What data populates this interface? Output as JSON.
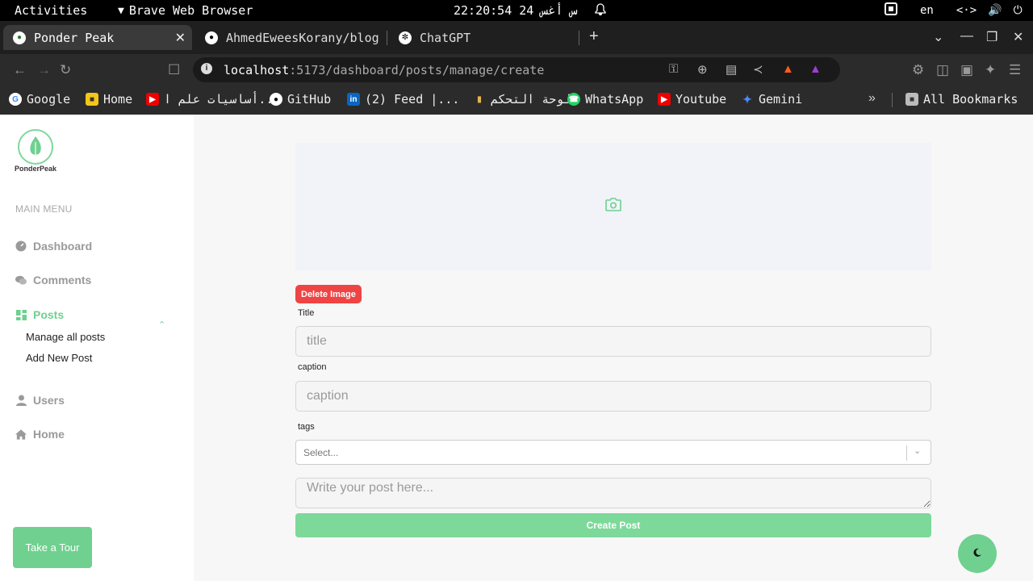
{
  "system_bar": {
    "activities": "Activities",
    "app_name": "Brave Web Browser",
    "clock": "22:20:54 24 س أغس",
    "language": "en"
  },
  "tabs": [
    {
      "title": "Ponder Peak",
      "active": true
    },
    {
      "title": "AhmedEweesKorany/blog",
      "active": false
    },
    {
      "title": "ChatGPT",
      "active": false
    }
  ],
  "address_bar": {
    "host": "localhost",
    "path": ":5173/dashboard/posts/manage/create"
  },
  "bookmarks": [
    {
      "label": "Google",
      "icon": "google-icon"
    },
    {
      "label": "Home",
      "icon": "home-folder-icon"
    },
    {
      "label": "أساسيات علم ا...",
      "icon": "youtube-icon"
    },
    {
      "label": "GitHub",
      "icon": "github-icon"
    },
    {
      "label": "(2) Feed |...",
      "icon": "linkedin-icon"
    },
    {
      "label": "لوحة التحكم",
      "icon": "dashboard-icon"
    },
    {
      "label": "WhatsApp",
      "icon": "whatsapp-icon"
    },
    {
      "label": "Youtube",
      "icon": "youtube-icon"
    },
    {
      "label": "Gemini",
      "icon": "gemini-icon"
    }
  ],
  "all_bookmarks": "All Bookmarks",
  "sidebar": {
    "brand": "PonderPeak",
    "menu_header": "MAIN MENU",
    "items": [
      {
        "label": "Dashboard",
        "icon": "gauge-icon"
      },
      {
        "label": "Comments",
        "icon": "comments-icon"
      },
      {
        "label": "Posts",
        "icon": "grid-icon",
        "active": true,
        "children": [
          "Manage all posts",
          "Add New Post"
        ]
      },
      {
        "label": "Users",
        "icon": "user-icon"
      },
      {
        "label": "Home",
        "icon": "house-icon"
      }
    ],
    "tour_button": "Take a Tour"
  },
  "form": {
    "delete_image": "Delete Image",
    "title_label": "Title",
    "title_placeholder": "title",
    "caption_label": "caption",
    "caption_placeholder": "caption",
    "tags_label": "tags",
    "tags_placeholder": "Select...",
    "body_placeholder": "Write your post here...",
    "submit": "Create Post"
  },
  "colors": {
    "accent": "#6fd08f",
    "danger": "#ef4444",
    "browser_dark": "#2b2b2b"
  }
}
